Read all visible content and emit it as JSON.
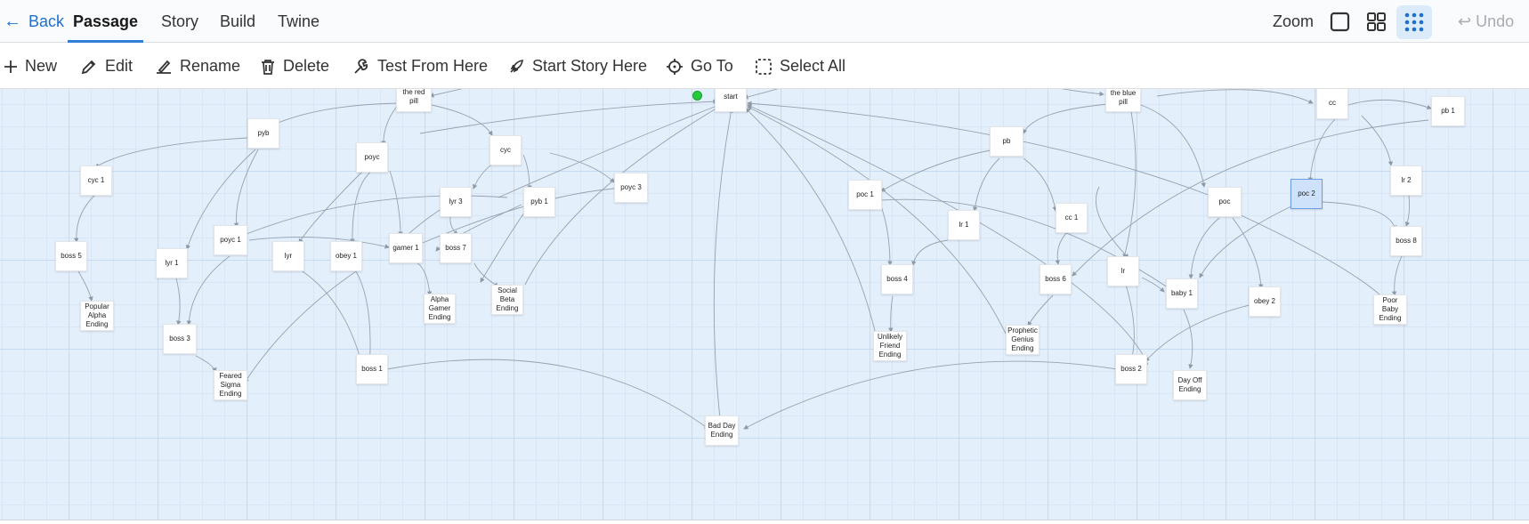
{
  "topbar": {
    "back": "Back",
    "tabs": [
      "Passage",
      "Story",
      "Build",
      "Twine"
    ],
    "zoom_label": "Zoom",
    "undo": "Undo"
  },
  "toolbar": {
    "new": "New",
    "edit": "Edit",
    "rename": "Rename",
    "delete": "Delete",
    "test_from_here": "Test From Here",
    "start_story_here": "Start Story Here",
    "go_to": "Go To",
    "select_all": "Select All"
  },
  "colors": {
    "accent": "#2f7ed8",
    "selected": "#cfe2fb",
    "start": "#27c93f",
    "canvas": "#e4effc"
  },
  "passages": {
    "the_red_pill": "the red pill",
    "start": "start",
    "the_blue_pill": "the blue pill",
    "cc": "cc",
    "pb_1": "pb 1",
    "pyb": "pyb",
    "poyc": "poyc",
    "cyc": "cyc",
    "pb": "pb",
    "cyc_1": "cyc 1",
    "poyc_3": "poyc 3",
    "lyr_3": "lyr 3",
    "pyb_1": "pyb 1",
    "poc_1": "poc 1",
    "poc": "poc",
    "poc_2": "poc 2",
    "lr_2": "lr 2",
    "cc_1": "cc 1",
    "lr_1": "lr 1",
    "poyc_1": "poyc 1",
    "boss_5": "boss 5",
    "lyr_1": "lyr 1",
    "lyr": "lyr",
    "obey_1": "obey 1",
    "gamer_1": "gamer 1",
    "boss_7": "boss 7",
    "boss_8": "boss 8",
    "boss_4": "boss 4",
    "boss_6": "boss 6",
    "lr": "lr",
    "baby_1": "baby 1",
    "obey_2": "obey 2",
    "popular_alpha_ending": "Popular Alpha Ending",
    "alpha_gamer_ending": "Alpha Gamer Ending",
    "social_beta_ending": "Social Beta Ending",
    "poor_baby_ending": "Poor Baby Ending",
    "boss_3": "boss 3",
    "unlikely_friend_ending": "Unlikely Friend Ending",
    "prophetic_genius_ending": "Prophetic Genius Ending",
    "boss_1": "boss 1",
    "feared_sigma_ending": "Feared Sigma Ending",
    "boss_2": "boss 2",
    "day_off_ending": "Day Off Ending",
    "bad_day_ending": "Bad Day Ending"
  }
}
